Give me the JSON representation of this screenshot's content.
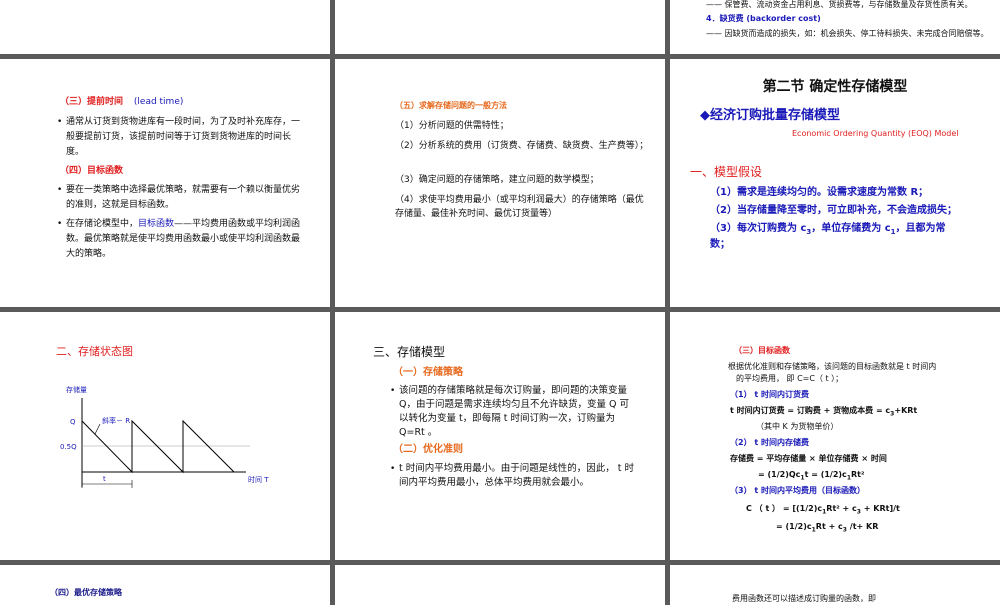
{
  "top_right": {
    "line1": "—— 保管费、流动资金占用利息、货损费等，与存储数量及存货性质有关。",
    "line2": "4．缺货费 (backorder cost)",
    "line3": "—— 因缺货而造成的损失，如：机会损失、停工待料损失、未完成合同赔偿等。"
  },
  "slide_lead": {
    "heading": "（三）提前时间",
    "heading_en": "(lead time)",
    "p1": "通常从订货到货物进库有一段时间，为了及时补充库存，一般要提前订货，该提前时间等于订货到货物进库的时间长度。",
    "heading2": "（四）目标函数",
    "p2": "要在一类策略中选择最优策略，就需要有一个赖以衡量优劣的准则，这就是目标函数。",
    "p3_pre": "在存储论模型中，",
    "p3_blue": "目标函数",
    "p3_post": "——平均费用函数或平均利润函数。最优策略就是使平均费用函数最小或使平均利润函数最大的策略。"
  },
  "slide_method": {
    "heading": "（五）求解存储问题的一般方法",
    "items": [
      "（1）分析问题的供需特性；",
      "（2）分析系统的费用（订货费、存储费、缺货费、生产费等）；",
      "（3）确定问题的存储策略，建立问题的数学模型；",
      "（4）求使平均费用最小（或平均利润最大）的存储策略（最优存储量、最佳补充时间、最优订货量等）"
    ]
  },
  "slide_eoq": {
    "title": "第二节 确定性存储模型",
    "subtitle": "◆经济订购批量存储模型",
    "subtitle_en": "Economic Ordering Quantity (EOQ) Model",
    "section": "一、模型假设",
    "a1": "（1）需求是连续均匀的。设需求速度为常数 R；",
    "a2": "（2）当存储量降至零时，可立即补充，不会造成损失；",
    "a3": "（3）每次订购费为 c",
    "a3_sub": "3",
    "a3_mid": "，单位存储费为 c",
    "a3_sub2": "1",
    "a3_end": "，且都为常",
    "a3_line2": "数；"
  },
  "slide_state": {
    "heading": "二、存储状态图",
    "y_label": "存储量",
    "q_label": "Q",
    "half_label": "0.5Q",
    "slope_label": "斜率－ R",
    "t_label": "t",
    "x_label": "时间 T"
  },
  "slide_model": {
    "title": "三、存储模型",
    "h1": "（一）存储策略",
    "p1": "该问题的存储策略就是每次订购量，即问题的决策变量 Q，由于问题是需求连续均匀且不允许缺货，变量 Q 可以转化为变量 t，即每隔 t 时间订购一次，订购量为 Q=Rt 。",
    "h2": "（二）优化准则",
    "p2": "t 时间内平均费用最小。由于问题是线性的，因此， t 时间内平均费用最小，总体平均费用就会最小。"
  },
  "slide_objective": {
    "heading": "（三）目标函数",
    "intro1": "根据优化准则和存储策略，该问题的目标函数就是 t 时间内",
    "intro2": "的平均费用，  即   C=C（ t ）；",
    "s1": "（1） t 时间内订货费",
    "s1_eq": "t 时间内订货费 =  订购费  +  货物成本费   = c",
    "s1_eq_sub": "3",
    "s1_eq_end": "+KRt",
    "s1_note": "（其中 K 为货物单价）",
    "s2": "（2） t 时间内存储费",
    "s2_eq": "存储费   =  平均存储量 × 单位存储费 × 时间",
    "s2_eq2": "= (1/2)Qc",
    "s2_eq2_sub": "1",
    "s2_eq2_end": "t = (1/2)c",
    "s2_eq2_sub2": "1",
    "s2_eq2_end2": "Rt²",
    "s3": "（3） t 时间内平均费用（目标函数）",
    "s3_eq1": "C （ t ）  = [(1/2)c",
    "s3_eq1_sub": "1",
    "s3_eq1_mid": "Rt² + c",
    "s3_eq1_sub2": "3",
    "s3_eq1_end": " + KRt]/t",
    "s3_eq2": "= (1/2)c",
    "s3_eq2_sub": "1",
    "s3_eq2_mid": "Rt + c",
    "s3_eq2_sub2": "3",
    "s3_eq2_end": " /t+ KR"
  },
  "bottom": {
    "left": "（四）最优存储策略",
    "right": "费用函数还可以描述成订购量的函数，即"
  }
}
